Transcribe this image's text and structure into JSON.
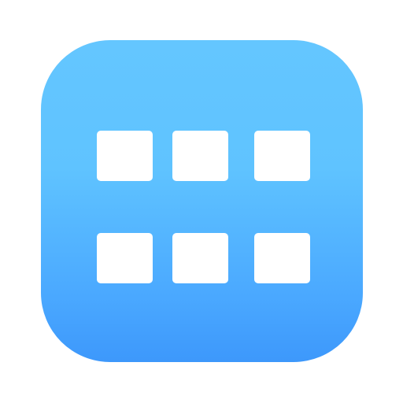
{
  "icon": {
    "name": "grid-view-icon",
    "gradient_top": "#64c6ff",
    "gradient_bottom": "#3d98fb",
    "tile_color": "#ffffff",
    "rows": 2,
    "columns": 3
  }
}
